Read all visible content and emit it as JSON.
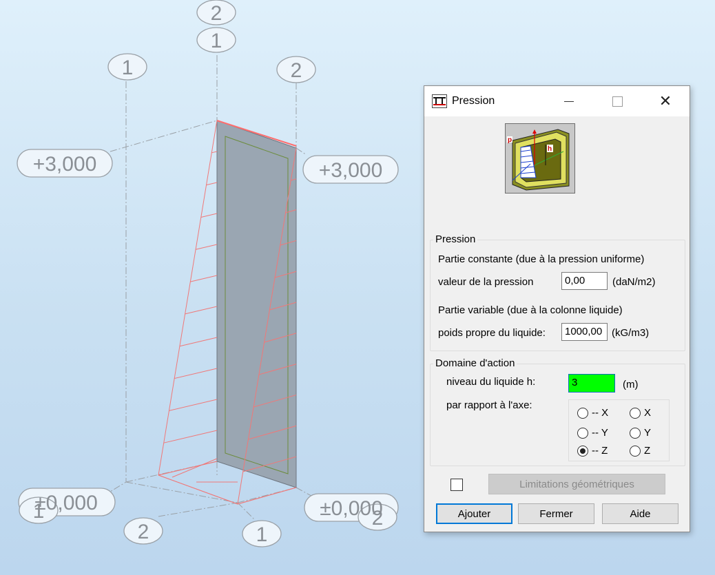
{
  "viewport": {
    "grid_labels": {
      "top_2": "2",
      "top_1": "1",
      "left_1": "1",
      "right_2": "2",
      "level_left_top": "+3,000",
      "level_right_top": "+3,000",
      "level_left_bottom": "±0,000",
      "level_right_bottom": "±0,000",
      "bottom_left_1": "1",
      "bottom_right_2": "2",
      "bottom_2": "2",
      "bottom_1": "1"
    }
  },
  "dialog": {
    "title": "Pression",
    "controls": {
      "close": "✕"
    },
    "pression_group": {
      "label": "Pression",
      "constant_label": "Partie constante (due à la pression uniforme)",
      "value_label": "valeur de la pression",
      "value": "0,00",
      "value_unit": "(daN/m2)",
      "variable_label": "Partie variable (due à la colonne liquide)",
      "weight_label": "poids propre du liquide:",
      "weight_value": "1000,00",
      "weight_unit": "(kG/m3)"
    },
    "domaine_group": {
      "label": "Domaine d'action",
      "level_label": "niveau du liquide h:",
      "level_value": "3",
      "level_unit": "(m)",
      "axis_label": "par rapport à l'axe:",
      "radios": [
        {
          "label": "-- X",
          "checked": false
        },
        {
          "label": "X",
          "checked": false
        },
        {
          "label": "-- Y",
          "checked": false
        },
        {
          "label": "Y",
          "checked": false
        },
        {
          "label": "-- Z",
          "checked": true
        },
        {
          "label": "Z",
          "checked": false
        }
      ]
    },
    "limits_button": "Limitations géométriques",
    "buttons": {
      "add": "Ajouter",
      "close": "Fermer",
      "help": "Aide"
    },
    "illustration_labels": {
      "p": "p",
      "h": "h"
    }
  },
  "colors": {
    "load_lines": "#f07878",
    "panel_fill": "#9aa6b2",
    "grid_bubble": "#8a8f95",
    "level_input_bg": "#00ff00"
  }
}
